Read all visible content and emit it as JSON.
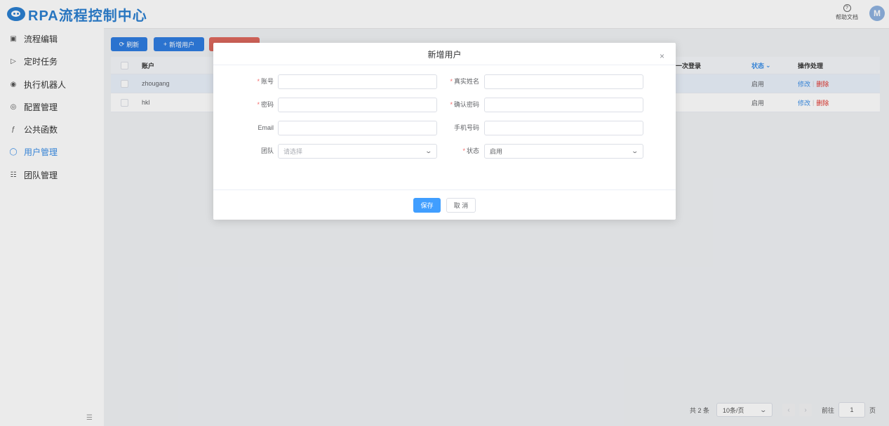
{
  "header": {
    "app_title": "RPA流程控制中心",
    "help_label": "帮助文档",
    "avatar_initial": "M",
    "brand_color": "#2b7fd1"
  },
  "sidebar": {
    "items": [
      {
        "label": "流程编辑",
        "icon": "monitor-icon"
      },
      {
        "label": "定时任务",
        "icon": "play-icon"
      },
      {
        "label": "执行机器人",
        "icon": "robot-icon"
      },
      {
        "label": "配置管理",
        "icon": "gear-icon"
      },
      {
        "label": "公共函数",
        "icon": "function-icon"
      },
      {
        "label": "用户管理",
        "icon": "user-icon",
        "active": true
      },
      {
        "label": "团队管理",
        "icon": "team-icon"
      }
    ]
  },
  "toolbar": {
    "refresh_label": "刷新",
    "add_label": "新增用户"
  },
  "table": {
    "columns": [
      "账户",
      "一次登录",
      "状态",
      "操作处理"
    ],
    "rows": [
      {
        "account": "zhougang",
        "status": "启用",
        "edit": "修改",
        "delete": "删除"
      },
      {
        "account": "hkl",
        "status": "启用",
        "edit": "修改",
        "delete": "删除"
      }
    ]
  },
  "pagination": {
    "total": "共 2 条",
    "page_size": "10条/页",
    "goto_label": "前往",
    "page": "1",
    "page_suffix": "页"
  },
  "dialog": {
    "title": "新增用户",
    "fields": {
      "account_label": "账号",
      "realname_label": "真实姓名",
      "password_label": "密码",
      "confirm_password_label": "确认密码",
      "email_label": "Email",
      "phone_label": "手机号码",
      "team_label": "团队",
      "team_placeholder": "请选择",
      "status_label": "状态",
      "status_value": "启用"
    },
    "save_label": "保存",
    "cancel_label": "取 消"
  },
  "colors": {
    "primary": "#409eff",
    "danger": "#e0322a",
    "active_nav": "#3b8fe8"
  }
}
